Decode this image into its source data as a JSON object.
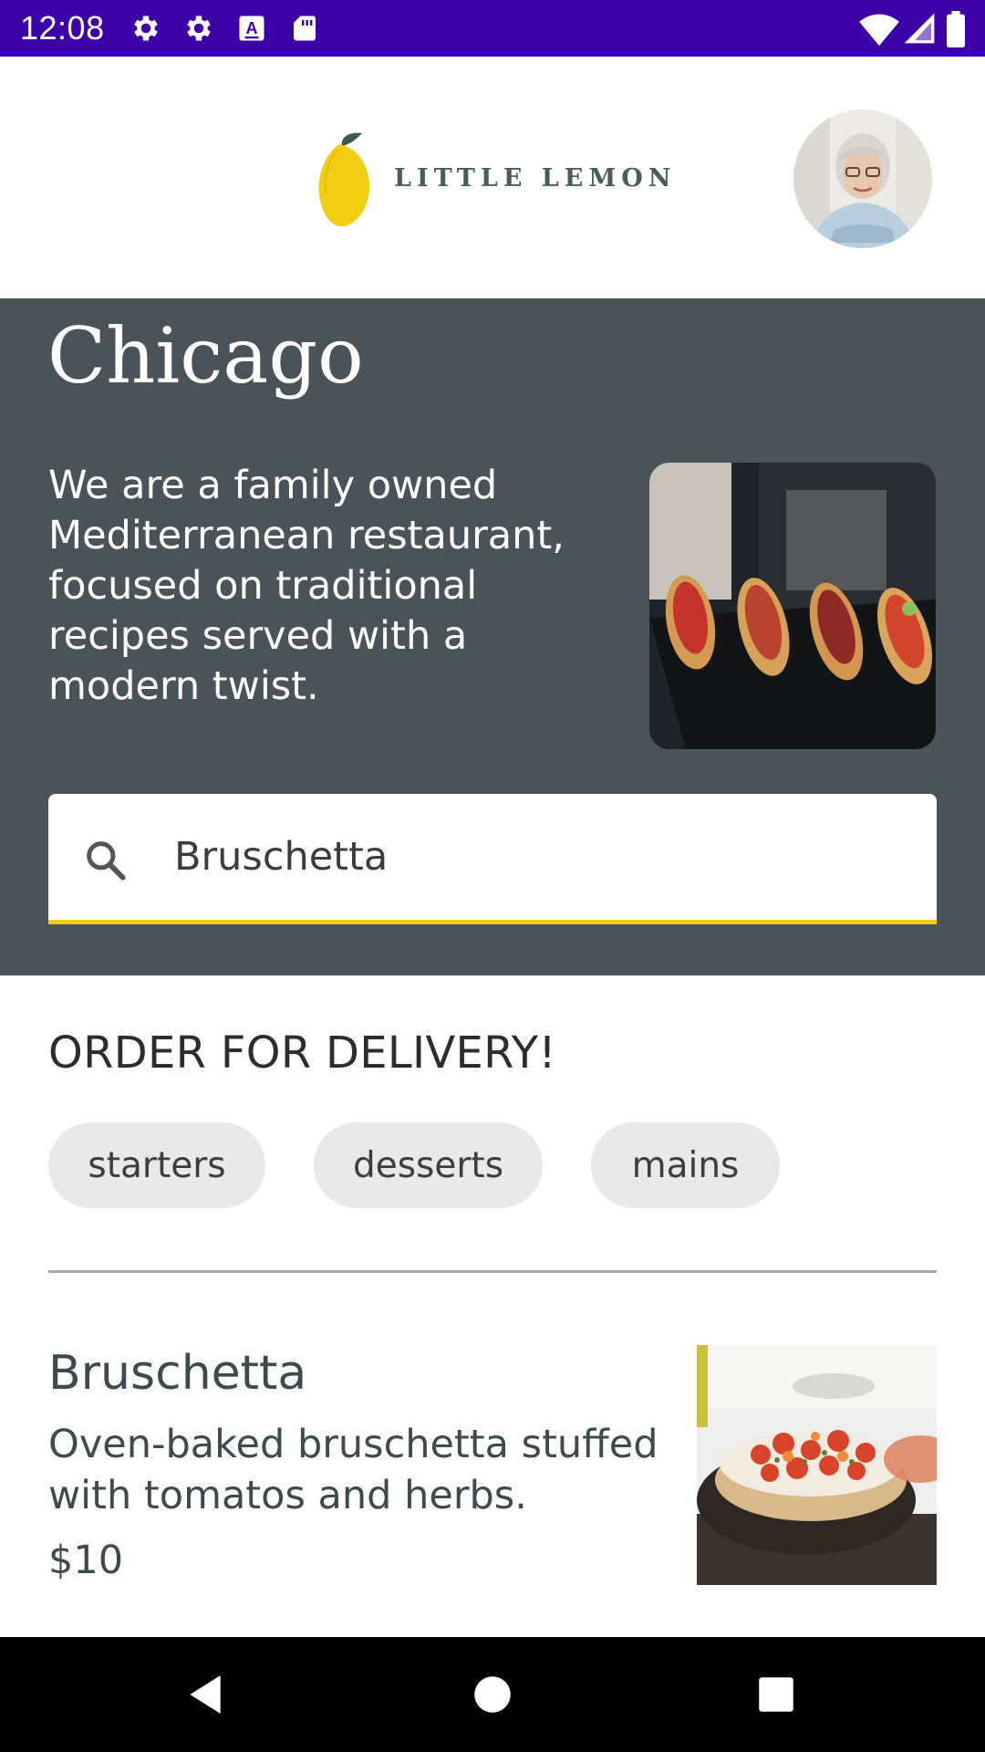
{
  "status_bar": {
    "time": "12:08",
    "left_icons": [
      "gear-icon",
      "gear-icon",
      "keyboard-a-icon",
      "sd-card-icon"
    ],
    "right_icons": [
      "wifi-icon",
      "cell-signal-icon",
      "battery-icon"
    ],
    "background_color": "#3c02a8"
  },
  "header": {
    "logo_text": "LITTLE LEMON",
    "logo_icon": "lemon-icon",
    "avatar_icon": "profile-avatar"
  },
  "hero": {
    "city": "Chicago",
    "description": "We are a family owned Mediterranean restaurant, focused on traditional recipes served with a modern twist.",
    "image_icon": "bruschetta-platter-photo",
    "background_color": "#4a5458"
  },
  "search": {
    "value": "Bruschetta",
    "placeholder": "",
    "accent_color": "#f4ce14"
  },
  "order": {
    "title": "ORDER FOR DELIVERY!",
    "categories": [
      "starters",
      "desserts",
      "mains"
    ]
  },
  "menu_items": [
    {
      "name": "Bruschetta",
      "description": "Oven-baked bruschetta stuffed with tomatos and herbs.",
      "price": "$10",
      "image_icon": "bruschetta-photo"
    }
  ],
  "nav_bar": {
    "buttons": [
      "back-icon",
      "home-icon",
      "recents-icon"
    ]
  }
}
